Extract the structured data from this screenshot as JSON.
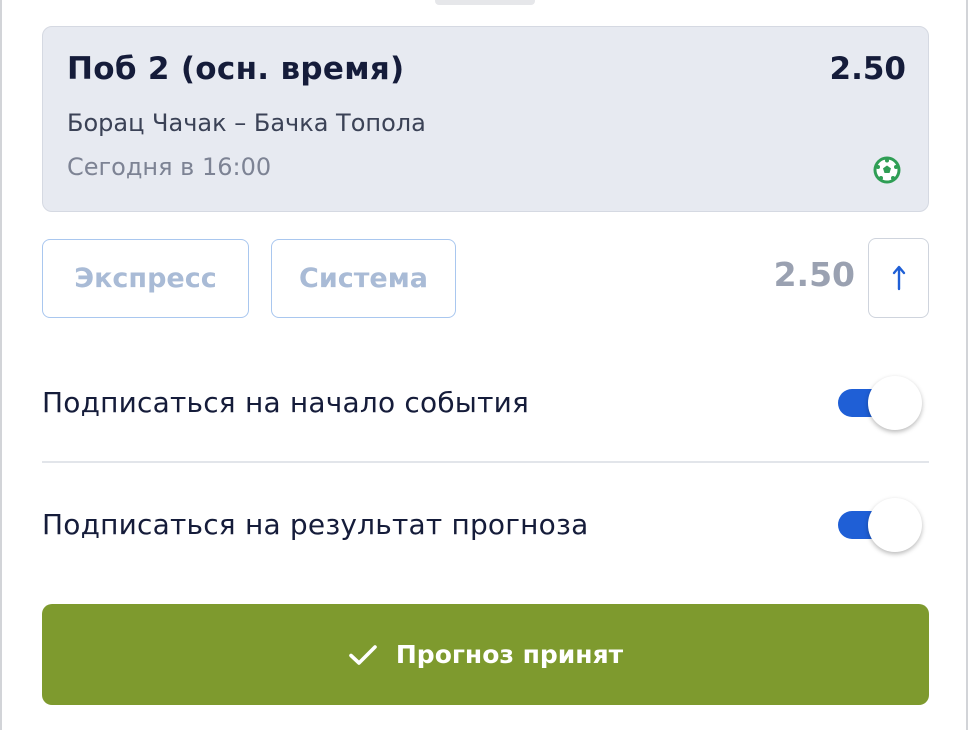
{
  "bet": {
    "market": "Поб 2 (осн. время)",
    "odds": "2.50",
    "match": "Борац Чачак – Бачка Топола",
    "time": "Сегодня в 16:00",
    "sport_icon": "soccer-ball-icon"
  },
  "modes": {
    "express_label": "Экспресс",
    "system_label": "Система"
  },
  "total": {
    "odds": "2.50",
    "raise_icon": "↑"
  },
  "subscriptions": [
    {
      "label": "Подписаться на начало события",
      "enabled": true
    },
    {
      "label": "Подписаться на результат прогноза",
      "enabled": true
    }
  ],
  "confirm": {
    "label": "Прогноз принят",
    "icon": "check-icon"
  },
  "colors": {
    "accent": "#1f5fd6",
    "success": "#7e9a2e",
    "card_bg": "#e7eaf1",
    "text_primary": "#151c3a"
  }
}
